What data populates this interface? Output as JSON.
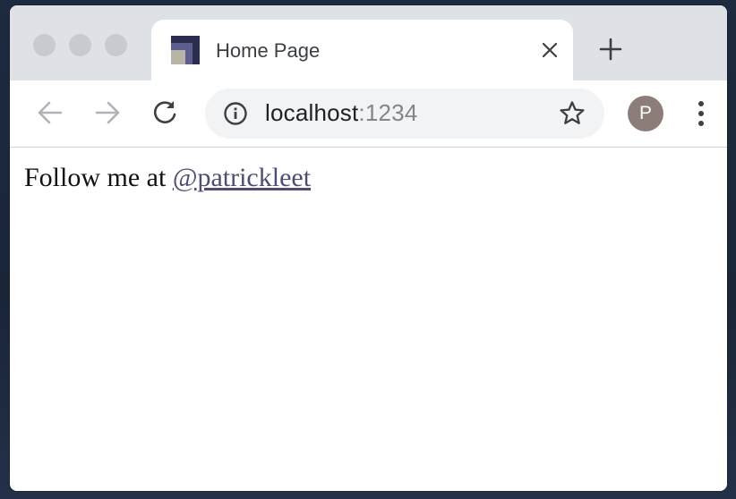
{
  "browser": {
    "tab": {
      "title": "Home Page",
      "favicon": "site-logo-squares",
      "close_icon": "close-icon"
    },
    "new_tab_icon": "plus-icon",
    "toolbar": {
      "back_icon": "arrow-left-icon",
      "forward_icon": "arrow-right-icon",
      "reload_icon": "reload-icon",
      "info_icon": "info-icon",
      "bookmark_icon": "star-icon",
      "menu_icon": "vertical-dots-icon"
    },
    "address": {
      "host": "localhost",
      "port": ":1234"
    },
    "profile": {
      "initial": "P",
      "color": "#8d7d78"
    }
  },
  "page": {
    "text_prefix": "Follow me at ",
    "link_text": "@patrickleet",
    "link_color": "#4e4d73"
  }
}
